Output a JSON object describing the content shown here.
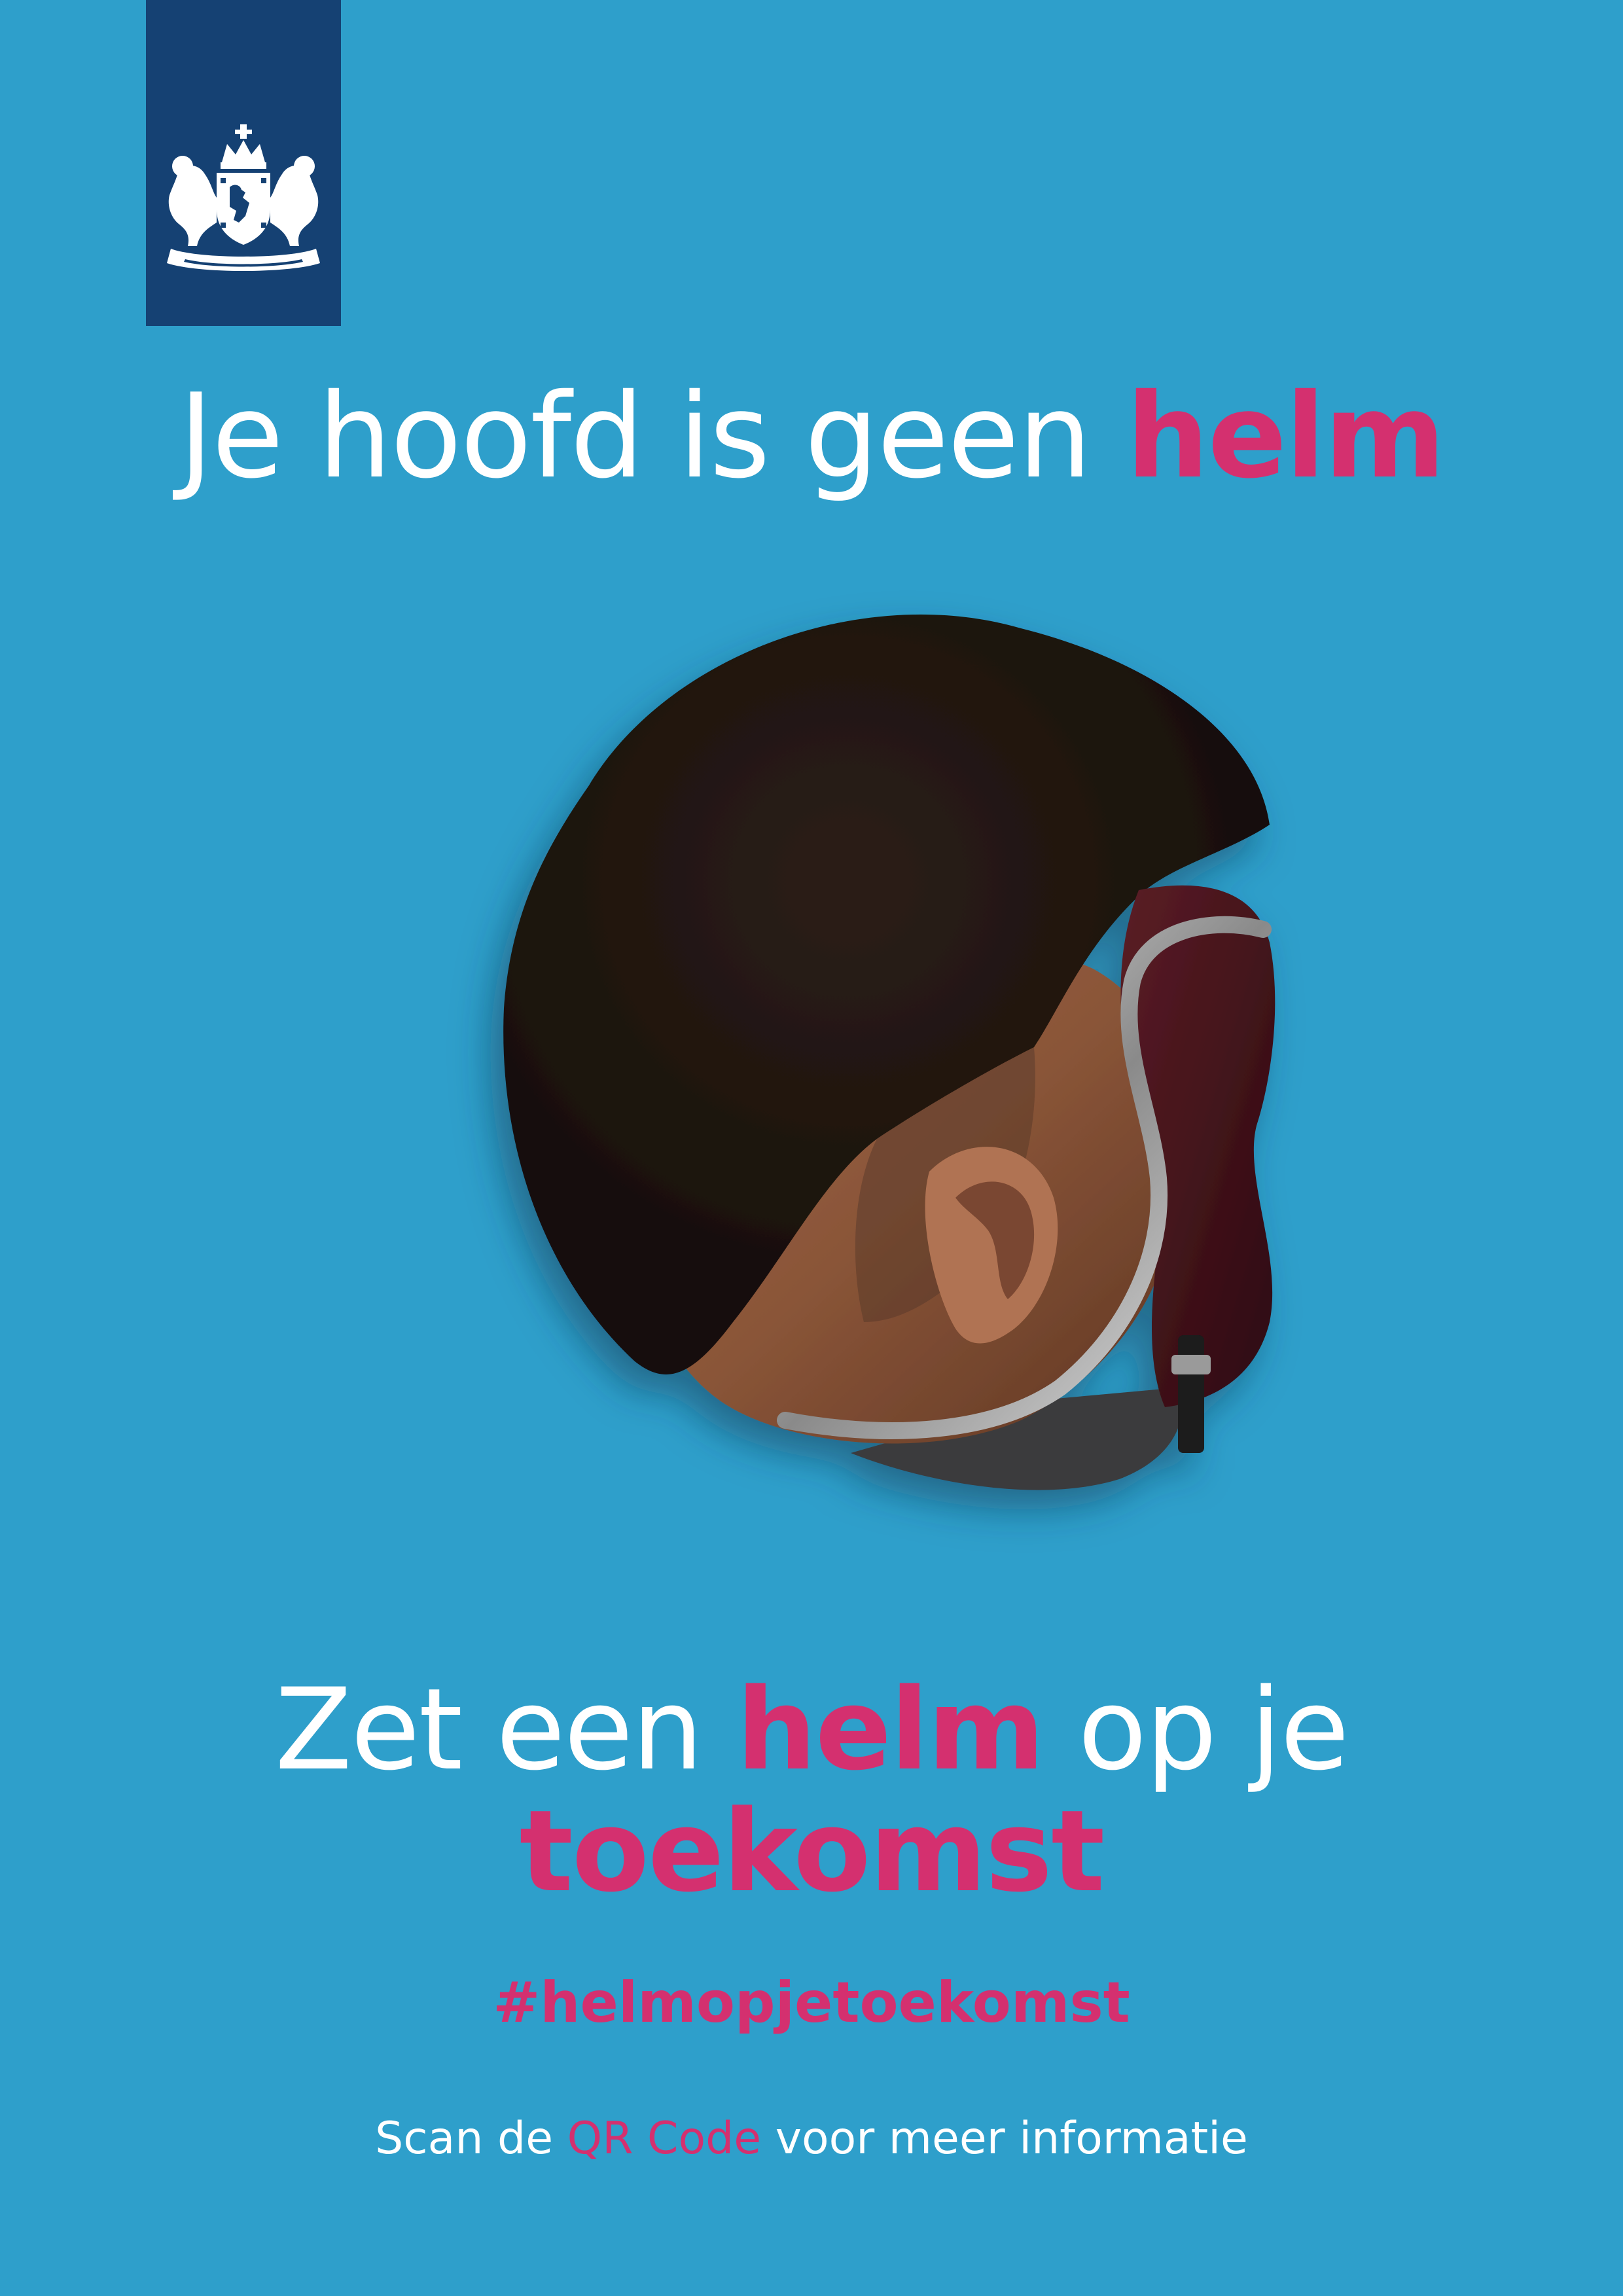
{
  "colors": {
    "background": "#2e9fcb",
    "logo_box": "#154173",
    "accent": "#d4306f",
    "text": "#ffffff"
  },
  "logo": {
    "icon": "coat-of-arms-icon"
  },
  "headline": {
    "part1": "Je hoofd is geen ",
    "part2": "helm"
  },
  "slogan": {
    "part1": "Zet een ",
    "part2": "helm",
    "part3": " op je",
    "part4": "toekomst"
  },
  "hashtag": "#helmopjetoekomst",
  "scan": {
    "part1": "Scan de ",
    "part2": "QR Code",
    "part3": " voor meer informatie"
  }
}
